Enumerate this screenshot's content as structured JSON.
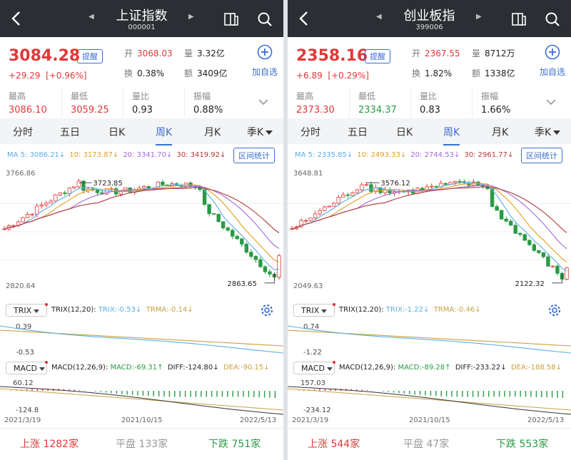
{
  "colors": {
    "up": "#e03838",
    "down": "#2a9a45",
    "accent": "#3a6fd0",
    "ma5": "#5aaee6",
    "ma10": "#e0a020",
    "ma20": "#a26ad8",
    "ma30": "#b03a3a",
    "trix": "#5aaee6",
    "trma": "#c8a040"
  },
  "common": {
    "remind_label": "提醒",
    "add_watch_label": "加自选",
    "labels": {
      "open": "开",
      "volume": "量",
      "turnover_rate": "换",
      "amount": "额",
      "high": "最高",
      "low": "最低",
      "vol_ratio": "量比",
      "amplitude": "振幅"
    },
    "tabs": [
      "分时",
      "五日",
      "日K",
      "周K",
      "月K",
      "季K"
    ],
    "active_tab": 3,
    "interval_label": "区间统计",
    "trix_selector": "TRIX",
    "macd_selector": "MACD",
    "trix_params": "TRIX(12,20):",
    "macd_params": "MACD(12,26,9):",
    "dates": [
      "2021/3/19",
      "2021/10/15",
      "2022/5/13"
    ],
    "breadth_labels": {
      "up": "上涨",
      "flat": "平盘",
      "down": "下跌"
    }
  },
  "panels": [
    {
      "title": "上证指数",
      "code": "000001",
      "price": "3084.28",
      "change": "+29.29",
      "change_pct": "[+0.96%]",
      "open": "3068.03",
      "volume": "3.32亿",
      "turnover_rate": "0.38%",
      "amount": "3409亿",
      "high": "3086.10",
      "low": "3059.25",
      "vol_ratio": "0.93",
      "amplitude": "0.88%",
      "ma": {
        "ma5": "MA 5: 3086.21↓",
        "ma10": "10: 3173.87↓",
        "ma20": "20: 3341.70↓",
        "ma30": "30: 3419.92↓"
      },
      "y_top": "3766.86",
      "y_bottom": "2820.64",
      "peak_label": "3723.85",
      "trough_label": "2863.65",
      "trix": {
        "trix": "TRIX:-0.53↓",
        "trma": "TRMA:-0.14↓",
        "top": "0.39",
        "bottom": "-0.53"
      },
      "macd": {
        "macd": "MACD:-69.31↑",
        "diff": "DIFF:-124.80↓",
        "dea": "DEA:-90.15↓",
        "top": "60.12",
        "bottom": "-124.8"
      },
      "breadth": {
        "up": "1282家",
        "flat": "133家",
        "down": "751家"
      }
    },
    {
      "title": "创业板指",
      "code": "399006",
      "price": "2358.16",
      "change": "+6.89",
      "change_pct": "[+0.29%]",
      "open": "2367.55",
      "volume": "8712万",
      "turnover_rate": "1.82%",
      "amount": "1338亿",
      "high": "2373.30",
      "low": "2334.37",
      "vol_ratio": "0.83",
      "amplitude": "1.66%",
      "ma": {
        "ma5": "MA 5: 2335.85↓",
        "ma10": "10: 2493.33↓",
        "ma20": "20: 2744.53↓",
        "ma30": "30: 2961.77↓"
      },
      "y_top": "3648.81",
      "y_bottom": "2049.63",
      "peak_label": "3576.12",
      "trough_label": "2122.32",
      "trix": {
        "trix": "TRIX:-1.22↓",
        "trma": "TRMA:-0.46↓",
        "top": "0.74",
        "bottom": "-1.22"
      },
      "macd": {
        "macd": "MACD:-89.28↑",
        "diff": "DIFF:-233.22↓",
        "dea": "DEA:-188.58↓",
        "top": "157.03",
        "bottom": "-234.12"
      },
      "breadth": {
        "up": "544家",
        "flat": "47家",
        "down": "553家"
      }
    }
  ]
}
